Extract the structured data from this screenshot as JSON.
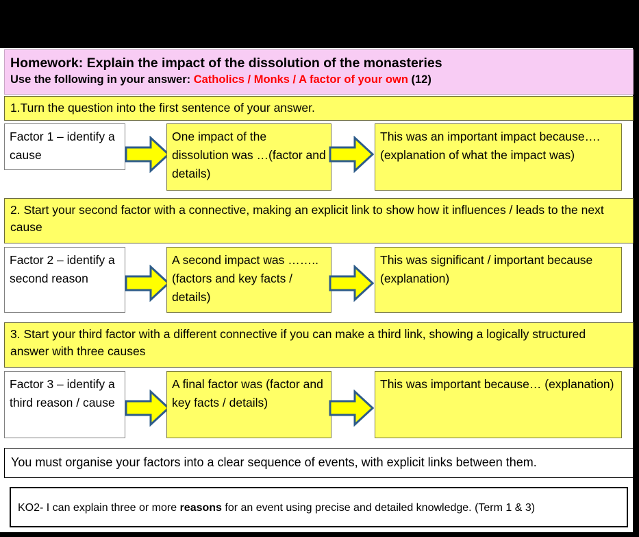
{
  "header": {
    "title": "Homework: Explain the impact of the dissolution of the monasteries",
    "instruction_prefix": "Use the following in your answer: ",
    "instruction_highlight": "Catholics / Monks / A factor of your own",
    "instruction_suffix": " (12)",
    "background_color": "#f8ccf4",
    "highlight_color": "#ff0000"
  },
  "steps": [
    {
      "id": "step-1",
      "text": "1.Turn the question into the first sentence of your answer."
    },
    {
      "id": "step-2",
      "text": "2. Start your second factor with a connective, making an explicit link to show how it influences / leads to the next cause"
    },
    {
      "id": "step-3",
      "text": "3. Start your third factor with a different connective if you can make a third link, showing a logically structured answer with three causes"
    }
  ],
  "rows": [
    {
      "id": "factor-row-1",
      "factor": "Factor 1 – identify a cause",
      "point": "One impact of the dissolution was …(factor and details)",
      "explanation": "This was an important impact because…. (explanation of what the impact was)"
    },
    {
      "id": "factor-row-2",
      "factor": "Factor 2 – identify a second reason",
      "point": "A second impact was …….. (factors and key facts / details)",
      "explanation": "This was significant / important because (explanation)"
    },
    {
      "id": "factor-row-3",
      "factor": "Factor 3 – identify a third reason / cause",
      "point": "A final factor was (factor and key facts / details)",
      "explanation": "This was important because… (explanation)"
    }
  ],
  "footer": {
    "organise_note": "You must organise your factors into a clear sequence of events, with explicit links between them.",
    "ko2_prefix": "KO2- I can explain three or more ",
    "ko2_bold": "reasons",
    "ko2_suffix": " for an event using precise and detailed knowledge. (Term 1 & 3)"
  },
  "colors": {
    "yellow_fill": "#ffff66",
    "arrow_fill": "#ffff00",
    "arrow_stroke": "#2e5c8a",
    "pink_fill": "#f8ccf4"
  }
}
